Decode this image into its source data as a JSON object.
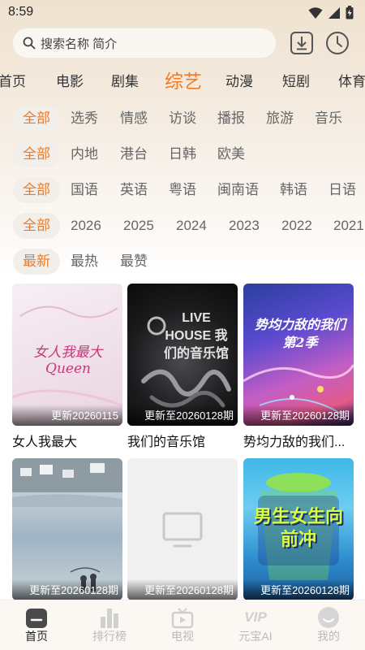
{
  "status": {
    "time": "8:59"
  },
  "search": {
    "placeholder": "搜索名称 简介"
  },
  "categories": [
    "首页",
    "电影",
    "剧集",
    "综艺",
    "动漫",
    "短剧",
    "体育"
  ],
  "active_category": "综艺",
  "filters": {
    "type": [
      "全部",
      "选秀",
      "情感",
      "访谈",
      "播报",
      "旅游",
      "音乐"
    ],
    "region": [
      "全部",
      "内地",
      "港台",
      "日韩",
      "欧美"
    ],
    "language": [
      "全部",
      "国语",
      "英语",
      "粤语",
      "闽南语",
      "韩语",
      "日语"
    ],
    "year": [
      "全部",
      "2026",
      "2025",
      "2024",
      "2023",
      "2022",
      "2021"
    ],
    "sort": [
      "最新",
      "最热",
      "最赞"
    ]
  },
  "cards": [
    {
      "title": "女人我最大",
      "update": "更新20260115",
      "poster_text": "女人我最大 Queen"
    },
    {
      "title": "我们的音乐馆",
      "update": "更新至20260128期",
      "poster_text": "LIVE HOUSE 我们的音乐馆"
    },
    {
      "title": "势均力敌的我们...",
      "update": "更新至20260128期",
      "poster_text": "势均力敌的我们 第2季"
    },
    {
      "title": "",
      "update": "更新至20260128期",
      "poster_text": ""
    },
    {
      "title": "",
      "update": "更新至20260128期",
      "poster_text": ""
    },
    {
      "title": "",
      "update": "更新至20260128期",
      "poster_text": "男生女生向前冲"
    }
  ],
  "bottom_nav": [
    {
      "label": "首页",
      "icon": "home-icon",
      "active": true
    },
    {
      "label": "排行榜",
      "icon": "ranking-icon",
      "active": false
    },
    {
      "label": "电视",
      "icon": "tv-icon",
      "active": false
    },
    {
      "label": "元宝AI",
      "icon": "vip-icon",
      "icon_text": "VIP",
      "active": false
    },
    {
      "label": "我的",
      "icon": "profile-icon",
      "active": false
    }
  ],
  "colors": {
    "accent": "#f07a26",
    "chip_bg": "#f2eeea"
  }
}
